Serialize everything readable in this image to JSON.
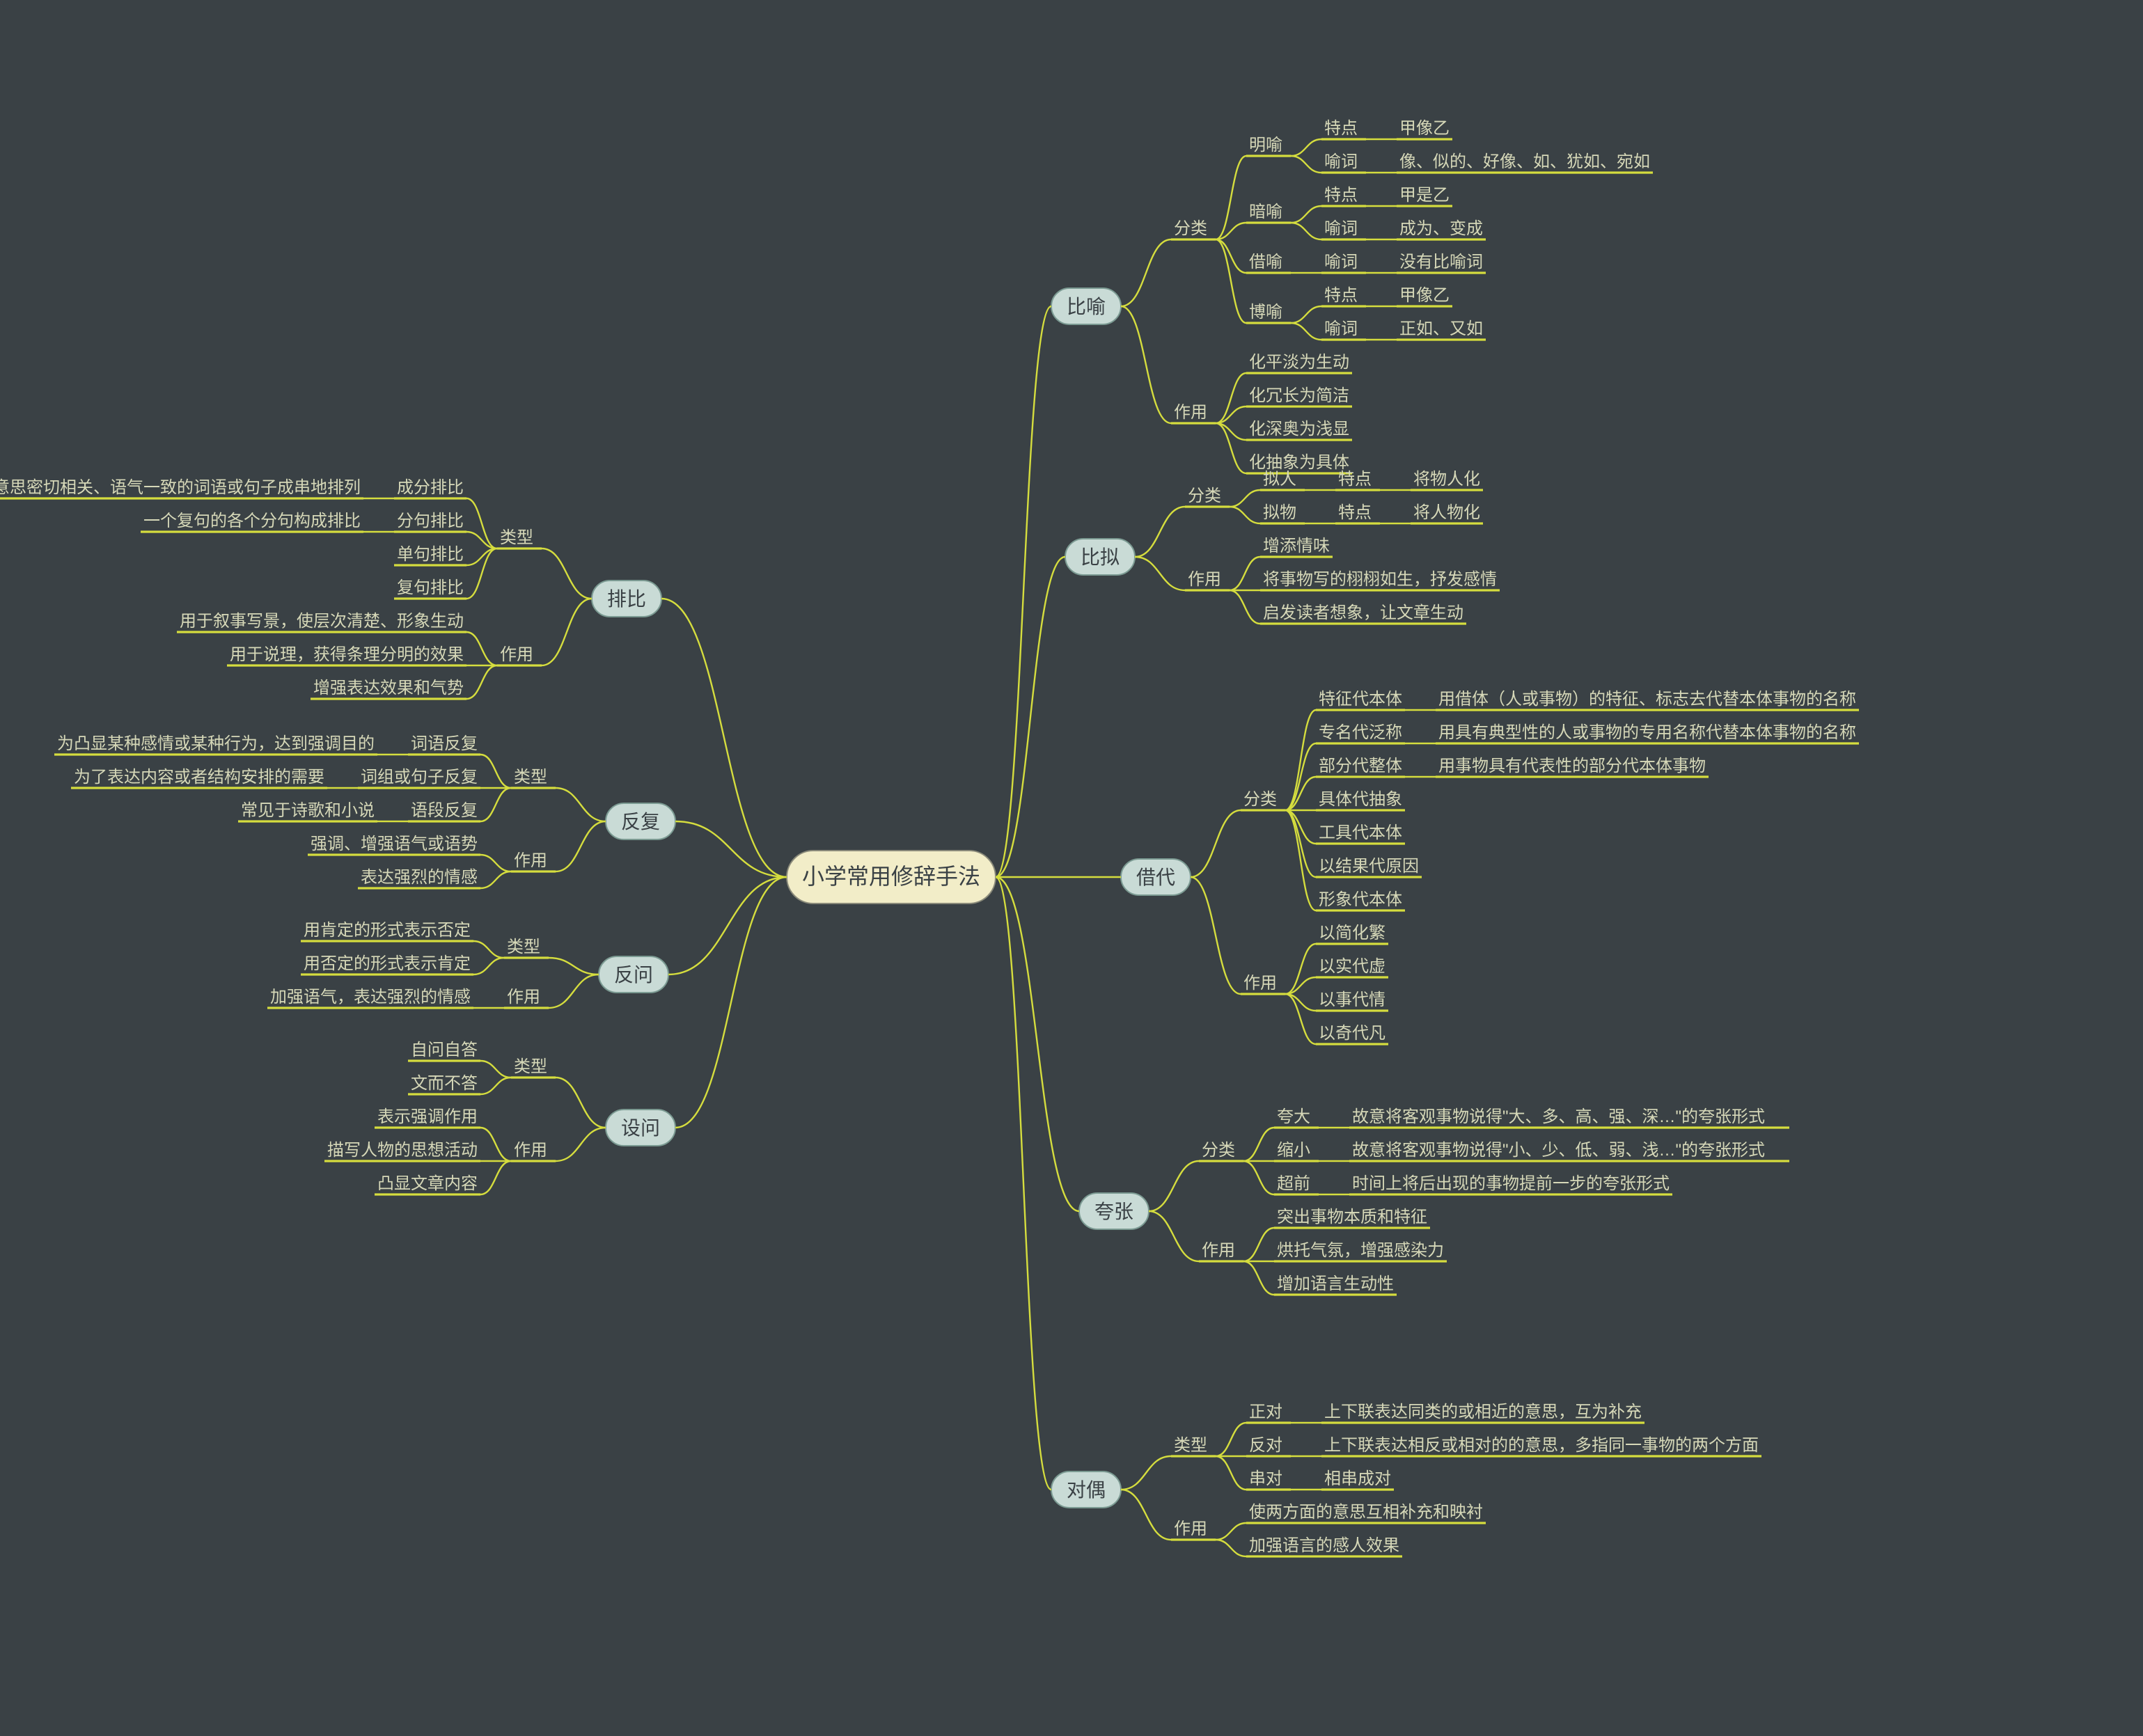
{
  "root": "小学常用修辞手法",
  "right": [
    {
      "name": "比喻",
      "children": [
        {
          "name": "分类",
          "children": [
            {
              "name": "明喻",
              "children": [
                {
                  "name": "特点",
                  "children": [
                    {
                      "name": "甲像乙"
                    }
                  ]
                },
                {
                  "name": "喻词",
                  "children": [
                    {
                      "name": "像、似的、好像、如、犹如、宛如"
                    }
                  ]
                }
              ]
            },
            {
              "name": "暗喻",
              "children": [
                {
                  "name": "特点",
                  "children": [
                    {
                      "name": "甲是乙"
                    }
                  ]
                },
                {
                  "name": "喻词",
                  "children": [
                    {
                      "name": "成为、变成"
                    }
                  ]
                }
              ]
            },
            {
              "name": "借喻",
              "children": [
                {
                  "name": "喻词",
                  "children": [
                    {
                      "name": "没有比喻词"
                    }
                  ]
                }
              ]
            },
            {
              "name": "博喻",
              "children": [
                {
                  "name": "特点",
                  "children": [
                    {
                      "name": "甲像乙"
                    }
                  ]
                },
                {
                  "name": "喻词",
                  "children": [
                    {
                      "name": "正如、又如"
                    }
                  ]
                }
              ]
            }
          ]
        },
        {
          "name": "作用",
          "children": [
            {
              "name": "化平淡为生动"
            },
            {
              "name": "化冗长为简洁"
            },
            {
              "name": "化深奥为浅显"
            },
            {
              "name": "化抽象为具体"
            }
          ]
        }
      ]
    },
    {
      "name": "比拟",
      "children": [
        {
          "name": "分类",
          "children": [
            {
              "name": "拟人",
              "children": [
                {
                  "name": "特点",
                  "children": [
                    {
                      "name": "将物人化"
                    }
                  ]
                }
              ]
            },
            {
              "name": "拟物",
              "children": [
                {
                  "name": "特点",
                  "children": [
                    {
                      "name": "将人物化"
                    }
                  ]
                }
              ]
            }
          ]
        },
        {
          "name": "作用",
          "children": [
            {
              "name": "增添情味"
            },
            {
              "name": "将事物写的栩栩如生，抒发感情"
            },
            {
              "name": "启发读者想象，让文章生动"
            }
          ]
        }
      ]
    },
    {
      "name": "借代",
      "children": [
        {
          "name": "分类",
          "children": [
            {
              "name": "特征代本体",
              "children": [
                {
                  "name": "用借体（人或事物）的特征、标志去代替本体事物的名称"
                }
              ]
            },
            {
              "name": "专名代泛称",
              "children": [
                {
                  "name": "用具有典型性的人或事物的专用名称代替本体事物的名称"
                }
              ]
            },
            {
              "name": "部分代整体",
              "children": [
                {
                  "name": "用事物具有代表性的部分代本体事物"
                }
              ]
            },
            {
              "name": "具体代抽象"
            },
            {
              "name": "工具代本体"
            },
            {
              "name": "以结果代原因"
            },
            {
              "name": "形象代本体"
            }
          ]
        },
        {
          "name": "作用",
          "children": [
            {
              "name": "以简化繁"
            },
            {
              "name": "以实代虚"
            },
            {
              "name": "以事代情"
            },
            {
              "name": "以奇代凡"
            }
          ]
        }
      ]
    },
    {
      "name": "夸张",
      "children": [
        {
          "name": "分类",
          "children": [
            {
              "name": "夸大",
              "children": [
                {
                  "name": "故意将客观事物说得\"大、多、高、强、深…\"的夸张形式"
                }
              ]
            },
            {
              "name": "缩小",
              "children": [
                {
                  "name": "故意将客观事物说得\"小、少、低、弱、浅…\"的夸张形式"
                }
              ]
            },
            {
              "name": "超前",
              "children": [
                {
                  "name": "时间上将后出现的事物提前一步的夸张形式"
                }
              ]
            }
          ]
        },
        {
          "name": "作用",
          "children": [
            {
              "name": "突出事物本质和特征"
            },
            {
              "name": "烘托气氛，增强感染力"
            },
            {
              "name": "增加语言生动性"
            }
          ]
        }
      ]
    },
    {
      "name": "对偶",
      "children": [
        {
          "name": "类型",
          "children": [
            {
              "name": "正对",
              "children": [
                {
                  "name": "上下联表达同类的或相近的意思，互为补充"
                }
              ]
            },
            {
              "name": "反对",
              "children": [
                {
                  "name": "上下联表达相反或相对的的意思，多指同一事物的两个方面"
                }
              ]
            },
            {
              "name": "串对",
              "children": [
                {
                  "name": "相串成对"
                }
              ]
            }
          ]
        },
        {
          "name": "作用",
          "children": [
            {
              "name": "使两方面的意思互相补充和映衬"
            },
            {
              "name": "加强语言的感人效果"
            }
          ]
        }
      ]
    }
  ],
  "left": [
    {
      "name": "排比",
      "children": [
        {
          "name": "类型",
          "children": [
            {
              "name": "成分排比",
              "children": [
                {
                  "name": "一个句子把结构相同、相似、意思密切相关、语气一致的词语或句子成串地排列"
                }
              ]
            },
            {
              "name": "分句排比",
              "children": [
                {
                  "name": "一个复句的各个分句构成排比"
                }
              ]
            },
            {
              "name": "单句排比"
            },
            {
              "name": "复句排比"
            }
          ]
        },
        {
          "name": "作用",
          "children": [
            {
              "name": "用于叙事写景，使层次清楚、形象生动"
            },
            {
              "name": "用于说理，获得条理分明的效果"
            },
            {
              "name": "增强表达效果和气势"
            }
          ]
        }
      ]
    },
    {
      "name": "反复",
      "children": [
        {
          "name": "类型",
          "children": [
            {
              "name": "词语反复",
              "children": [
                {
                  "name": "为凸显某种感情或某种行为，达到强调目的"
                }
              ]
            },
            {
              "name": "词组或句子反复",
              "children": [
                {
                  "name": "为了表达内容或者结构安排的需要"
                }
              ]
            },
            {
              "name": "语段反复",
              "children": [
                {
                  "name": "常见于诗歌和小说"
                }
              ]
            }
          ]
        },
        {
          "name": "作用",
          "children": [
            {
              "name": "强调、增强语气或语势"
            },
            {
              "name": "表达强烈的情感"
            }
          ]
        }
      ]
    },
    {
      "name": "反问",
      "children": [
        {
          "name": "类型",
          "children": [
            {
              "name": "用肯定的形式表示否定"
            },
            {
              "name": "用否定的形式表示肯定"
            }
          ]
        },
        {
          "name": "作用",
          "children": [
            {
              "name": "加强语气，表达强烈的情感"
            }
          ]
        }
      ]
    },
    {
      "name": "设问",
      "children": [
        {
          "name": "类型",
          "children": [
            {
              "name": "自问自答"
            },
            {
              "name": "文而不答"
            }
          ]
        },
        {
          "name": "作用",
          "children": [
            {
              "name": "表示强调作用"
            },
            {
              "name": "描写人物的思想活动"
            },
            {
              "name": "凸显文章内容"
            }
          ]
        }
      ]
    }
  ]
}
